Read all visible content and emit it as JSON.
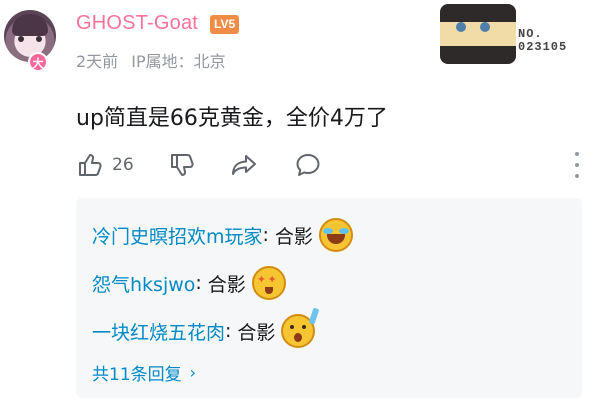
{
  "comment": {
    "user": {
      "name": "GHOST-Goat",
      "level": "LV5",
      "avatar_badge": "大"
    },
    "meta": {
      "time": "2天前",
      "ip_location": "IP属地：北京"
    },
    "decoration": {
      "number_label": "NO.",
      "number": "023105"
    },
    "text": "up简直是66克黄金，全价4万了",
    "actions": {
      "like_count": "26"
    },
    "replies": [
      {
        "user": "冷门史暝招欢m玩家",
        "separator": ":",
        "text": "合影",
        "emoji": "laughing-tears-emoji"
      },
      {
        "user": "怨气hksjwo",
        "separator": ":",
        "text": "合影",
        "emoji": "starry-eyes-emoji"
      },
      {
        "user": "一块红烧五花肉",
        "separator": ":",
        "text": "合影",
        "emoji": "shocked-emoji"
      }
    ],
    "replies_more": "共11条回复",
    "replies_more_chevron": "›"
  },
  "colors": {
    "username": "#fb7299",
    "level_badge": "#f08c45",
    "reply_user": "#008ac5",
    "meta_text": "#9499a0"
  }
}
